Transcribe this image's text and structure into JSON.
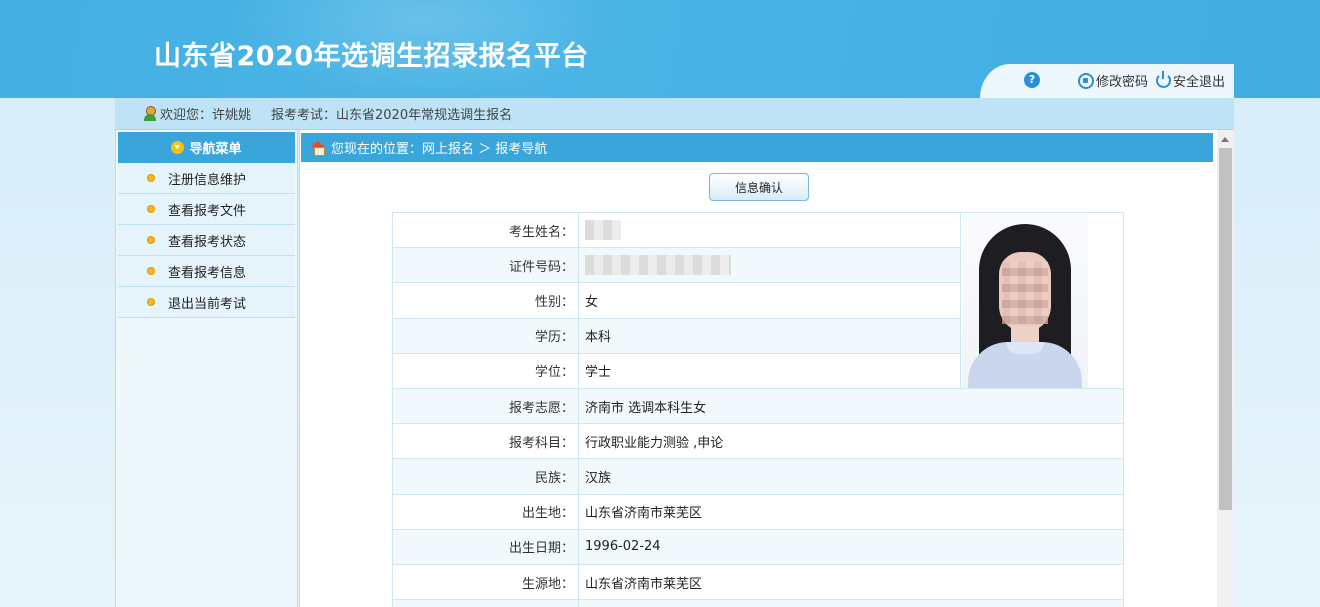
{
  "header": {
    "site_title": "山东省2020年选调生招录报名平台",
    "help_label": "?",
    "change_password": "修改密码",
    "logout": "安全退出"
  },
  "welcome": {
    "welcome_text": "欢迎您：许姚姚",
    "exam_text": "报考考试：山东省2020年常规选调生报名"
  },
  "sidebar": {
    "title": "导航菜单",
    "items": [
      {
        "label": "注册信息维护"
      },
      {
        "label": "查看报考文件"
      },
      {
        "label": "查看报考状态"
      },
      {
        "label": "查看报考信息"
      },
      {
        "label": "退出当前考试"
      }
    ]
  },
  "breadcrumb": {
    "text": "您现在的位置：网上报名 ＞ 报考导航"
  },
  "main": {
    "confirm_button": "信息确认"
  },
  "info_rows": [
    {
      "label": "考生姓名：",
      "value": ""
    },
    {
      "label": "证件号码：",
      "value": ""
    },
    {
      "label": "性别：",
      "value": "女"
    },
    {
      "label": "学历：",
      "value": "本科"
    },
    {
      "label": "学位：",
      "value": "学士"
    },
    {
      "label": "报考志愿：",
      "value": "济南市 选调本科生女"
    },
    {
      "label": "报考科目：",
      "value": "行政职业能力测验 ,申论"
    },
    {
      "label": "民族：",
      "value": "汉族"
    },
    {
      "label": "出生地：",
      "value": "山东省济南市莱芜区"
    },
    {
      "label": "出生日期：",
      "value": "1996-02-24"
    },
    {
      "label": "生源地：",
      "value": "山东省济南市莱芜区"
    }
  ],
  "colors": {
    "header_blue": "#43afe2",
    "nav_blue": "#3aa5db",
    "bullet_yellow": "#f3b81b"
  }
}
